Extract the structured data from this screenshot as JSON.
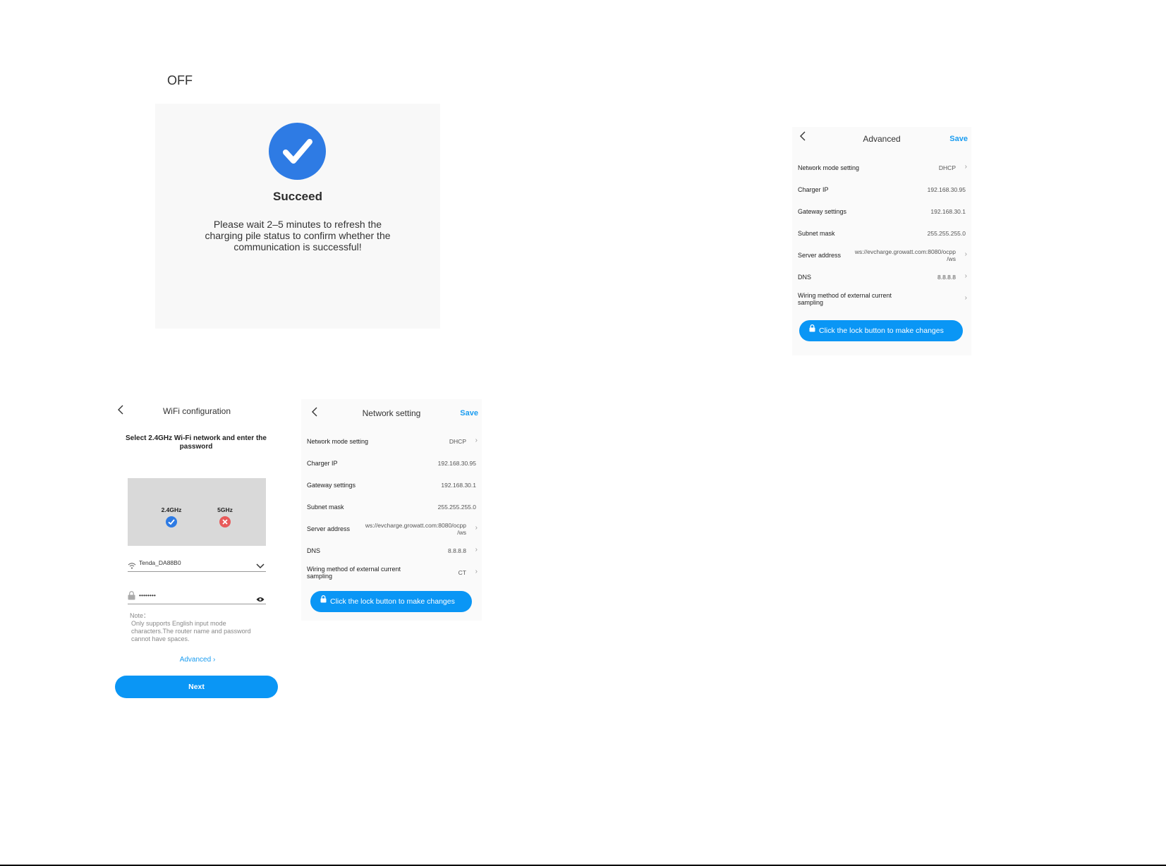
{
  "off_label": "OFF",
  "succeed": {
    "title": "Succeed",
    "message": "Please wait 2–5 minutes to refresh the charging pile status to confirm whether the communication is successful!",
    "accent": "#2e7be4"
  },
  "advanced": {
    "title": "Advanced",
    "save_label": "Save",
    "rows": [
      {
        "label": "Network mode setting",
        "value": "DHCP"
      },
      {
        "label": "Charger IP",
        "value": "192.168.30.95"
      },
      {
        "label": "Gateway settings",
        "value": "192.168.30.1"
      },
      {
        "label": "Subnet mask",
        "value": "255.255.255.0"
      },
      {
        "label": "Server address",
        "value_line1": "ws://evcharge.growatt.com:8080/ocpp",
        "value_line2": "/ws"
      },
      {
        "label": "DNS",
        "value": "8.8.8.8"
      },
      {
        "label_line1": "Wiring method of external current",
        "label_line2": "sampling",
        "value": ""
      }
    ],
    "lock_button": "Click the lock button to make changes"
  },
  "network": {
    "title": "Network setting",
    "save_label": "Save",
    "rows": [
      {
        "label": "Network mode setting",
        "value": "DHCP"
      },
      {
        "label": "Charger IP",
        "value": "192.168.30.95"
      },
      {
        "label": "Gateway settings",
        "value": "192.168.30.1"
      },
      {
        "label": "Subnet mask",
        "value": "255.255.255.0"
      },
      {
        "label": "Server address",
        "value_line1": "ws://evcharge.growatt.com:8080/ocpp",
        "value_line2": "/ws"
      },
      {
        "label": "DNS",
        "value": "8.8.8.8"
      },
      {
        "label_line1": "Wiring method of external current",
        "label_line2": "sampling",
        "value": "CT"
      }
    ],
    "lock_button": "Click the lock button to make changes"
  },
  "wifi": {
    "title": "WiFi configuration",
    "heading": "Select 2.4GHz Wi-Fi network and enter the password",
    "band_24": "2.4GHz",
    "band_5": "5GHz",
    "ssid": "Tenda_DA88B0",
    "password_mask": "••••••••",
    "note_title": "Note：",
    "note_body": "Only supports English input mode characters.The router name and password cannot have spaces.",
    "advanced_link": "Advanced",
    "next_button": "Next",
    "ok_color": "#2e7be4",
    "bad_color": "#e85a5a"
  }
}
